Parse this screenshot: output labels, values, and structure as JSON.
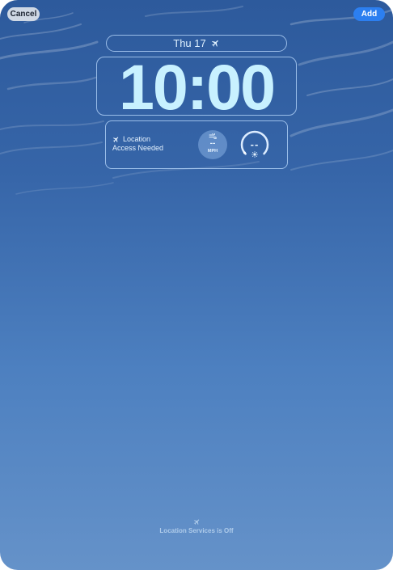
{
  "toolbar": {
    "cancel_label": "Cancel",
    "add_label": "Add",
    "add_color": "#2c7ff0"
  },
  "lock_screen": {
    "date": "Thu 17",
    "date_icon": "airplane-icon",
    "time": "10:00"
  },
  "widgets": {
    "location": {
      "icon": "airplane-icon",
      "line1": "Location",
      "line2": "Access Needed"
    },
    "wind": {
      "icon": "wind-icon",
      "value": "--",
      "unit": "MPH"
    },
    "uv": {
      "icon": "sun-icon",
      "value": "--"
    }
  },
  "footer": {
    "icon": "airplane-icon",
    "text": "Location Services is Off"
  },
  "colors": {
    "time_text": "#c8f1ff",
    "sky_top": "#2d5a9c",
    "sky_bottom": "#6592c9"
  }
}
